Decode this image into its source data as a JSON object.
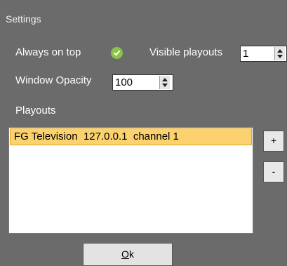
{
  "window": {
    "title": "Settings"
  },
  "options": {
    "always_on_top_label": "Always on top",
    "always_on_top_checked": true,
    "visible_playouts_label": "Visible playouts",
    "visible_playouts_value": "1",
    "window_opacity_label": "Window Opacity",
    "window_opacity_value": "100"
  },
  "playouts": {
    "label": "Playouts",
    "items": [
      {
        "name": "FG Television",
        "address": "127.0.0.1",
        "channel": "channel 1",
        "selected": true
      }
    ],
    "add_label": "+",
    "remove_label": "-"
  },
  "footer": {
    "ok_mnemonic": "O",
    "ok_rest": "k"
  },
  "colors": {
    "background": "#6b6b6b",
    "selection": "#fbd26e",
    "selection_border": "#e0a623",
    "check_green": "#8bc34a"
  },
  "icons": {
    "checked": "checkmark-circle-icon",
    "spin_up": "arrow-up-icon",
    "spin_down": "arrow-down-icon"
  }
}
